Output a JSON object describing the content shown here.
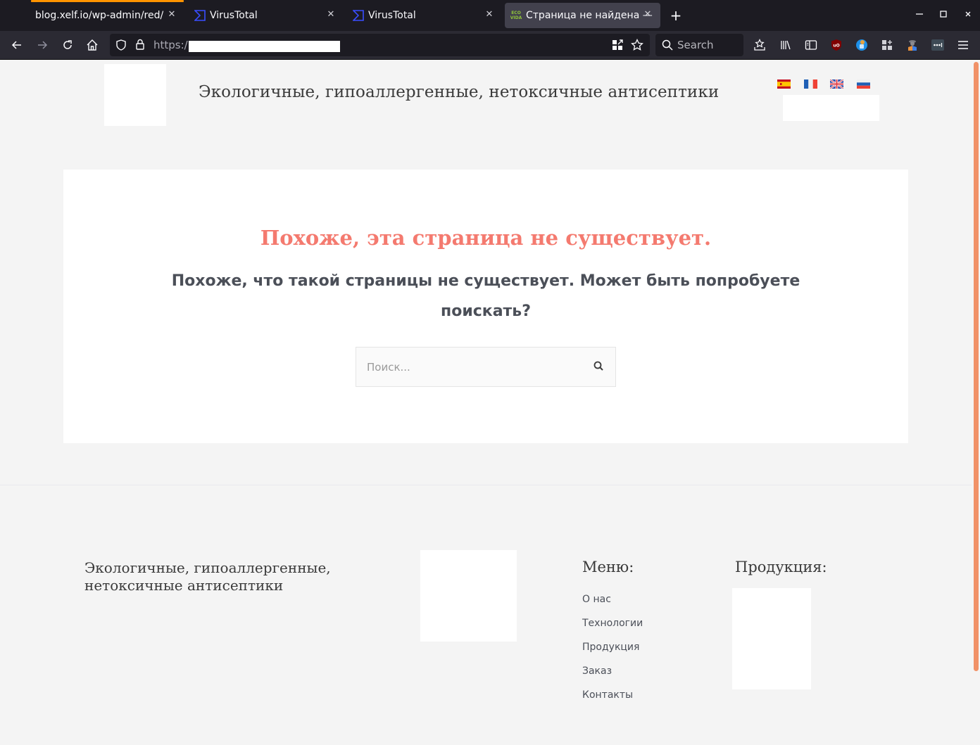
{
  "browser": {
    "tabs": [
      {
        "title": "blog.xelf.io/wp-admin/red/",
        "icon": "none",
        "active": false,
        "loading": true
      },
      {
        "title": "VirusTotal",
        "icon": "virustotal-icon",
        "active": false
      },
      {
        "title": "VirusTotal",
        "icon": "virustotal-icon",
        "active": false
      },
      {
        "title": "Страница не найдена —",
        "icon": "ecovida-favicon",
        "active": true
      }
    ],
    "favicon_text": {
      "line1": "ECO",
      "line2": "VIDA"
    },
    "tab_close_glyph": "✕",
    "new_tab_glyph": "+",
    "window_controls": {
      "minimize": "—",
      "maximize": "□",
      "close": "✕"
    },
    "url_prefix": "https:/",
    "search_placeholder": "Search",
    "accent_colors": {
      "loading_bar": "#ff9400",
      "virustotal": "#394eff",
      "ecovida": "#8fc33a"
    }
  },
  "header": {
    "site_title": "Экологичные, гипоаллергенные, нетоксичные антисептики",
    "languages": [
      {
        "code": "es",
        "name": "Español"
      },
      {
        "code": "fr",
        "name": "Français"
      },
      {
        "code": "en",
        "name": "English"
      },
      {
        "code": "ru",
        "name": "Русский"
      }
    ]
  },
  "main": {
    "error_title": "Похоже, эта страница не существует.",
    "error_subtitle": "Похоже, что такой страницы не существует. Может быть попробуете поискать?",
    "search": {
      "placeholder": "Поиск...",
      "value": ""
    },
    "title_color": "#f47a6f"
  },
  "footer": {
    "site_title": "Экологичные, гипоаллергенные, нетоксичные антисептики",
    "menu_heading": "Меню:",
    "menu_items": [
      "О нас",
      "Технологии",
      "Продукция",
      "Заказ",
      "Контакты"
    ],
    "products_heading": "Продукция:"
  },
  "scrollbar": {
    "color": "#f19268",
    "position_fraction": 0.0
  }
}
